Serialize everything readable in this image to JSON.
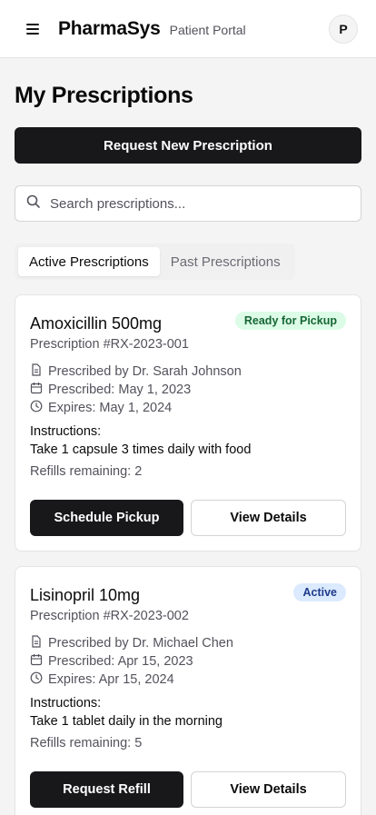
{
  "header": {
    "brand": "PharmaSys",
    "subtitle": "Patient Portal",
    "avatar_initial": "P",
    "menu_icon": "hamburger-menu-icon"
  },
  "page": {
    "title": "My Prescriptions",
    "request_button": "Request New Prescription"
  },
  "search": {
    "placeholder": "Search prescriptions...",
    "value": "",
    "icon": "search-icon"
  },
  "tabs": [
    {
      "label": "Active Prescriptions",
      "active": true
    },
    {
      "label": "Past Prescriptions",
      "active": false
    }
  ],
  "prescriptions": [
    {
      "drug": "Amoxicillin 500mg",
      "rx_number": "Prescription #RX-2023-001",
      "status": "Ready for Pickup",
      "status_color": "#166534",
      "status_bg": "#dcfce7",
      "prescriber": "Prescribed by Dr. Sarah Johnson",
      "prescribed_date": "Prescribed: May 1, 2023",
      "expires": "Expires: May 1, 2024",
      "instructions_label": "Instructions:",
      "instructions": "Take 1 capsule 3 times daily with food",
      "refills": "Refills remaining: 2",
      "primary_action": "Schedule Pickup",
      "secondary_action": "View Details"
    },
    {
      "drug": "Lisinopril 10mg",
      "rx_number": "Prescription #RX-2023-002",
      "status": "Active",
      "status_color": "#1e3a8a",
      "status_bg": "#dbeafe",
      "prescriber": "Prescribed by Dr. Michael Chen",
      "prescribed_date": "Prescribed: Apr 15, 2023",
      "expires": "Expires: Apr 15, 2024",
      "instructions_label": "Instructions:",
      "instructions": "Take 1 tablet daily in the morning",
      "refills": "Refills remaining: 5",
      "primary_action": "Request Refill",
      "secondary_action": "View Details"
    }
  ],
  "colors": {
    "primary": "#18181b",
    "background": "#f4f4f5"
  }
}
